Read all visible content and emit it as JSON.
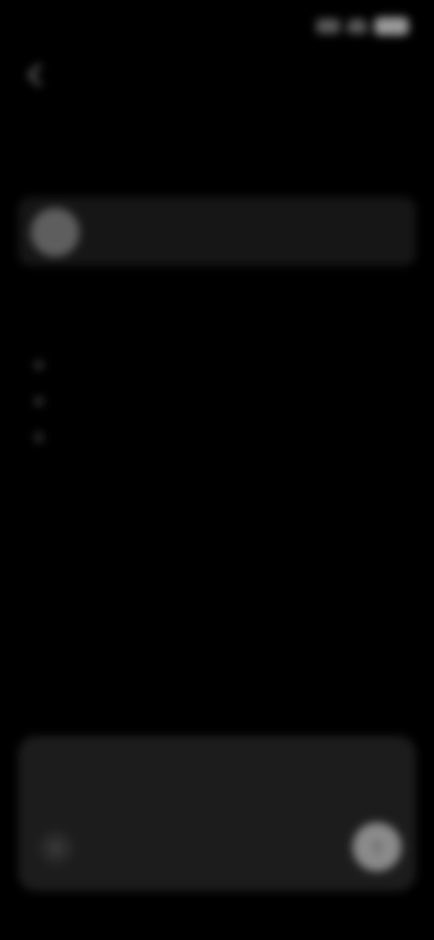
{
  "status_bar": {
    "time": "",
    "battery_icon": "battery-icon",
    "wifi_icon": "wifi-icon",
    "signal_icon": "signal-icon"
  },
  "nav": {
    "back_label": "",
    "back_icon": "chevron-left-icon"
  },
  "header": {
    "title": "",
    "subtitle": ""
  },
  "account_card": {
    "name": "",
    "action_label": ""
  },
  "description": {
    "line_1": "",
    "line_2": ""
  },
  "permissions": {
    "items": [
      {
        "label": ""
      },
      {
        "label": ""
      },
      {
        "label": ""
      }
    ],
    "detail_line_1": "",
    "detail_line_2": ""
  },
  "composer": {
    "placeholder": "",
    "add_icon": "plus-icon",
    "send_icon": "send-icon"
  },
  "colors": {
    "background": "#000000",
    "card": "#161616",
    "composer": "#1c1c1c",
    "send_button": "#8a8a8a"
  }
}
